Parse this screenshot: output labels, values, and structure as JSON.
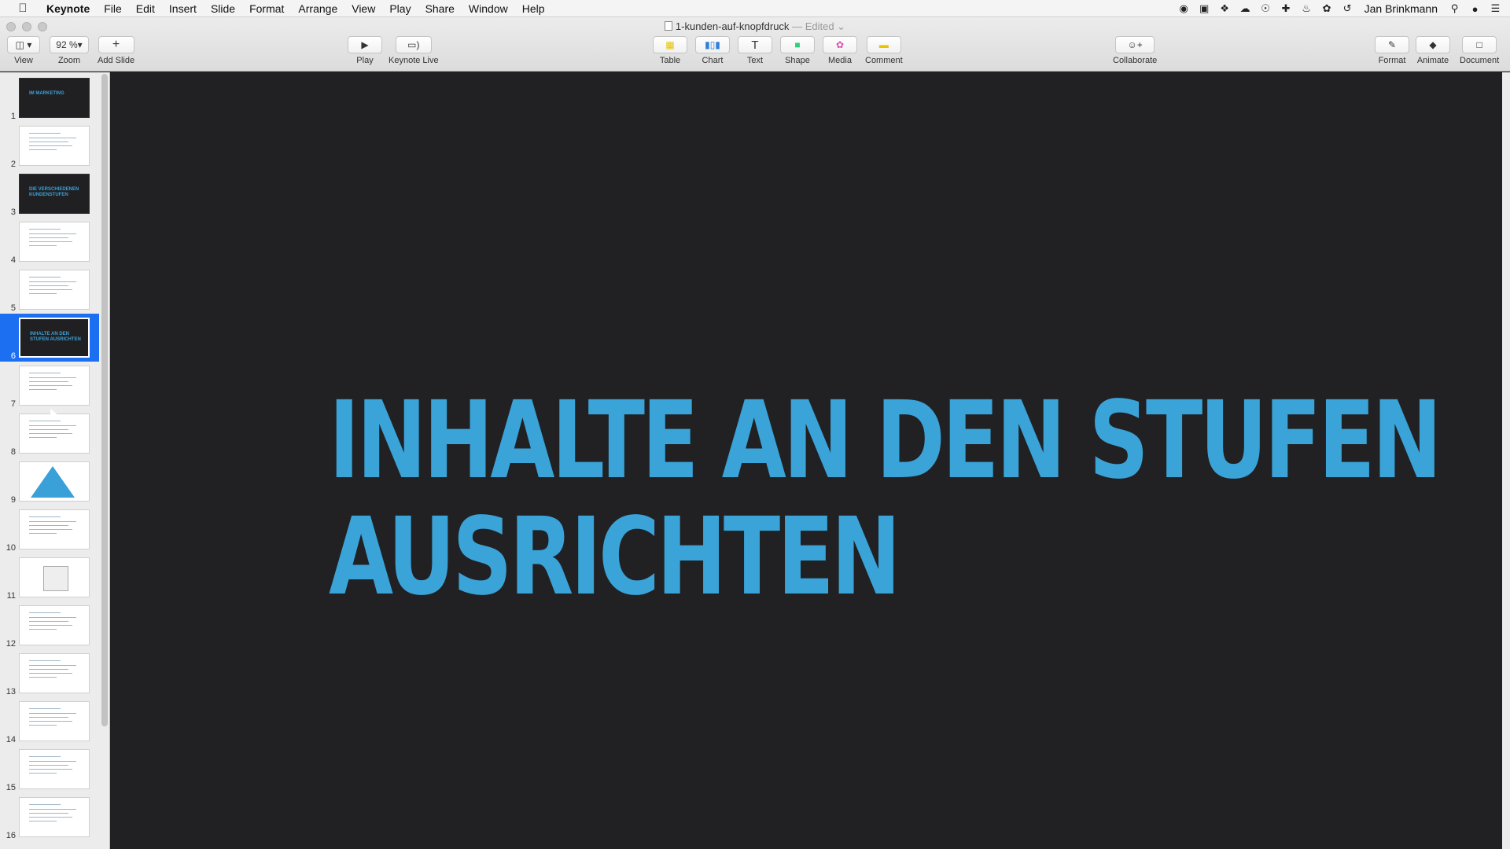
{
  "menubar": {
    "apple": "",
    "items": [
      "Keynote",
      "File",
      "Edit",
      "Insert",
      "Slide",
      "Format",
      "Arrange",
      "View",
      "Play",
      "Share",
      "Window",
      "Help"
    ],
    "user": "Jan Brinkmann"
  },
  "window": {
    "doc_name": "1-kunden-auf-knopfdruck",
    "separator": "—",
    "edited": "Edited"
  },
  "toolbar": {
    "view_label": "View",
    "zoom_value": "92 %",
    "zoom_label": "Zoom",
    "add_slide_label": "Add Slide",
    "play_label": "Play",
    "keynote_live_label": "Keynote Live",
    "table_label": "Table",
    "chart_label": "Chart",
    "text_label": "Text",
    "shape_label": "Shape",
    "media_label": "Media",
    "comment_label": "Comment",
    "collaborate_label": "Collaborate",
    "format_label": "Format",
    "animate_label": "Animate",
    "document_label": "Document"
  },
  "navigator": {
    "slides": [
      {
        "num": "1",
        "dark": true,
        "text": "IM MARKETING"
      },
      {
        "num": "2",
        "dark": false
      },
      {
        "num": "3",
        "dark": true,
        "text": "DIE VERSCHIEDENEN KUNDENSTUFEN"
      },
      {
        "num": "4",
        "dark": false
      },
      {
        "num": "5",
        "dark": false
      },
      {
        "num": "6",
        "dark": true,
        "text": "INHALTE AN DEN STUFEN AUSRICHTEN",
        "selected": true
      },
      {
        "num": "7",
        "dark": false
      },
      {
        "num": "8",
        "dark": false
      },
      {
        "num": "9",
        "dark": false,
        "triangle": true
      },
      {
        "num": "10",
        "dark": false
      },
      {
        "num": "11",
        "dark": false,
        "image": true
      },
      {
        "num": "12",
        "dark": false
      },
      {
        "num": "13",
        "dark": false
      },
      {
        "num": "14",
        "dark": false
      },
      {
        "num": "15",
        "dark": false
      },
      {
        "num": "16",
        "dark": false
      }
    ]
  },
  "slide": {
    "title_line1": "INHALTE AN DEN STUFEN",
    "title_line2": "AUSRICHTEN",
    "title_color": "#3aa3d8",
    "background": "#212123"
  },
  "colors": {
    "selection": "#1d6ff2",
    "accent": "#3aa3d8"
  }
}
